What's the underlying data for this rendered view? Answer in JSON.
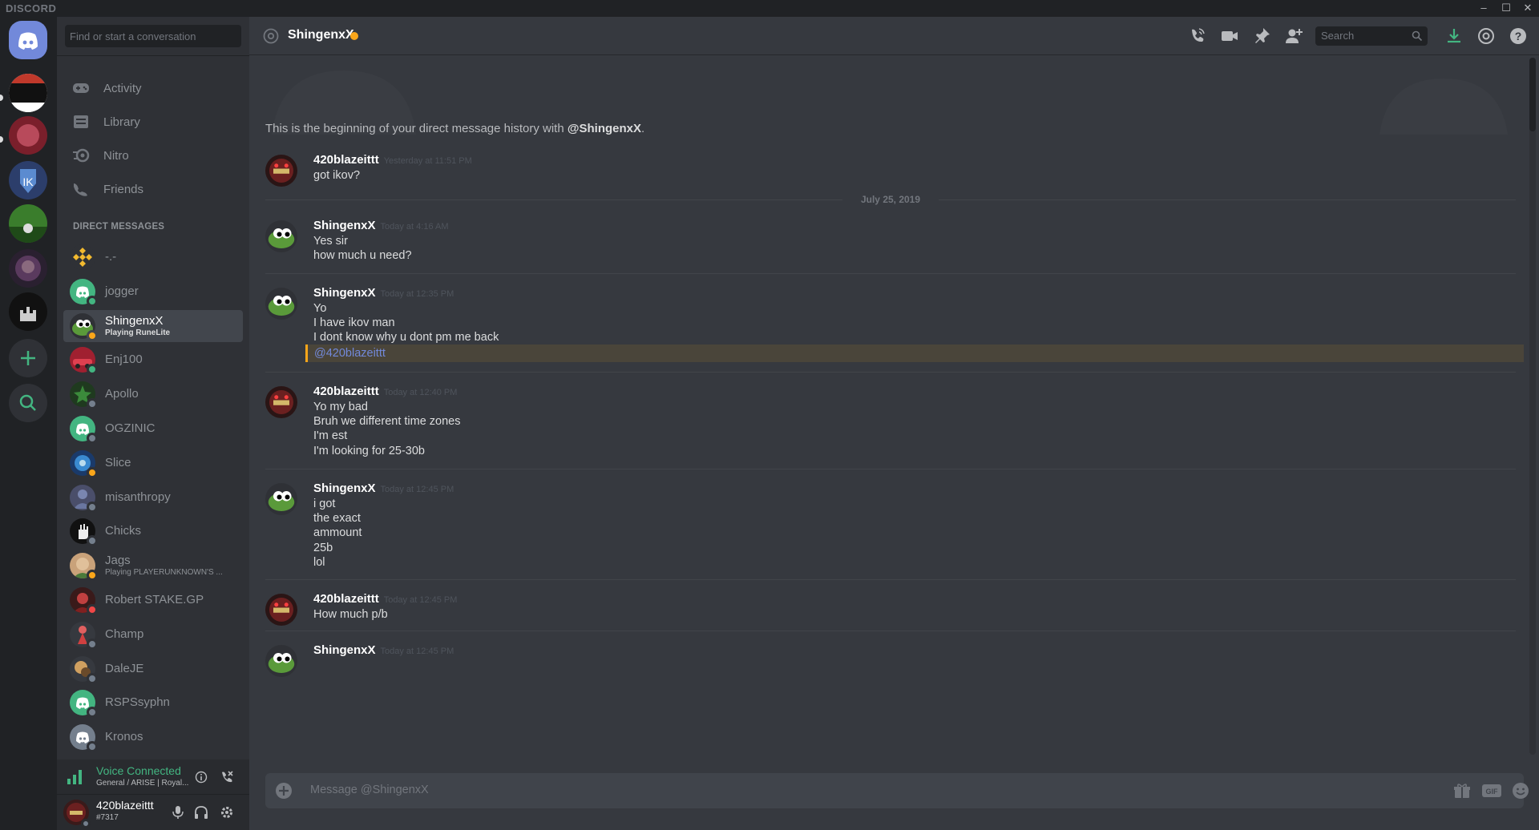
{
  "app": {
    "brand": "DISCORD",
    "window_buttons": [
      "–",
      "☐",
      "✕"
    ]
  },
  "search": {
    "placeholder": "Find or start a conversation"
  },
  "nav": [
    {
      "label": "Activity",
      "icon": "gamepad-icon"
    },
    {
      "label": "Library",
      "icon": "library-icon"
    },
    {
      "label": "Nitro",
      "icon": "nitro-icon"
    },
    {
      "label": "Friends",
      "icon": "friends-icon"
    }
  ],
  "dm_header": "DIRECT MESSAGES",
  "dms": [
    {
      "name": "-.-",
      "sub": "",
      "status": "none",
      "avatar": "binance"
    },
    {
      "name": "jogger",
      "sub": "",
      "status": "online",
      "avatar": "discord"
    },
    {
      "name": "ShingenxX",
      "sub": "Playing RuneLite",
      "status": "idle",
      "avatar": "frog",
      "selected": true
    },
    {
      "name": "Enj100",
      "sub": "",
      "status": "online",
      "avatar": "car"
    },
    {
      "name": "Apollo",
      "sub": "",
      "status": "offline",
      "avatar": "green"
    },
    {
      "name": "OGZINIC",
      "sub": "",
      "status": "offline",
      "avatar": "discord"
    },
    {
      "name": "Slice",
      "sub": "",
      "status": "idle",
      "avatar": "blue"
    },
    {
      "name": "misanthropy",
      "sub": "",
      "status": "offline",
      "avatar": "purple"
    },
    {
      "name": "Chicks",
      "sub": "",
      "status": "offline",
      "avatar": "hand"
    },
    {
      "name": "Jags",
      "sub": "Playing PLAYERUNKNOWN'S ...",
      "status": "idle",
      "avatar": "face"
    },
    {
      "name": "Robert STAKE.GP",
      "sub": "",
      "status": "dnd",
      "avatar": "red"
    },
    {
      "name": "Champ",
      "sub": "",
      "status": "offline",
      "avatar": "champ"
    },
    {
      "name": "DaleJE",
      "sub": "",
      "status": "offline",
      "avatar": "dale"
    },
    {
      "name": "RSPSsyphn",
      "sub": "",
      "status": "offline",
      "avatar": "discord"
    },
    {
      "name": "Kronos",
      "sub": "",
      "status": "offline",
      "avatar": "discordgrey"
    }
  ],
  "voice": {
    "status": "Voice Connected",
    "channel": "General / ARISE | Royal..."
  },
  "user": {
    "name": "420blazeittt",
    "tag": "#7317"
  },
  "chat": {
    "recipient": "ShingenxX",
    "search_placeholder": "Search",
    "beginning_prefix": "This is the beginning of your direct message history with ",
    "beginning_name": "@ShingenxX",
    "beginning_suffix": ".",
    "date_divider": "July 25, 2019",
    "composer_placeholder": "Message @ShingenxX",
    "groups": [
      {
        "author": "420blazeittt",
        "time": "Yesterday at 11:51 PM",
        "lines": [
          "got ikov?"
        ]
      },
      {
        "author": "ShingenxX",
        "time": "Today at 4:16 AM",
        "lines": [
          "Yes sir",
          "how much u need?"
        ]
      },
      {
        "author": "ShingenxX",
        "time": "Today at 12:35 PM",
        "lines": [
          "Yo",
          "I have ikov man",
          "I dont know why u dont pm me back"
        ],
        "mention": "@420blazeittt"
      },
      {
        "author": "420blazeittt",
        "time": "Today at 12:40 PM",
        "lines": [
          "Yo my bad",
          "Bruh we different time zones",
          "I'm est",
          "I'm looking for 25-30b"
        ]
      },
      {
        "author": "ShingenxX",
        "time": "Today at 12:45 PM",
        "lines": [
          "i got",
          "the exact",
          "ammount",
          "25b",
          "lol"
        ]
      },
      {
        "author": "420blazeittt",
        "time": "Today at 12:45 PM",
        "lines": [
          "How much p/b"
        ]
      },
      {
        "author": "ShingenxX",
        "time": "Today at 12:45 PM",
        "lines": []
      }
    ]
  },
  "colors": {
    "online": "#43b581",
    "idle": "#faa61a",
    "dnd": "#f04747",
    "offline": "#747f8d",
    "blurple": "#7289da",
    "green": "#43b581"
  }
}
